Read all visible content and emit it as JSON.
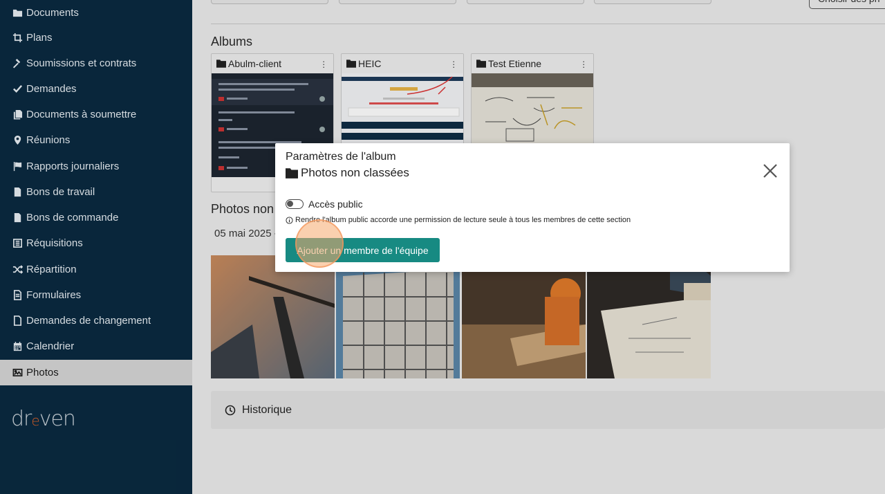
{
  "sidebar": {
    "items": [
      {
        "label": "Documents",
        "icon": "folder-icon"
      },
      {
        "label": "Plans",
        "icon": "crop-icon"
      },
      {
        "label": "Soumissions et contrats",
        "icon": "gavel-icon"
      },
      {
        "label": "Demandes",
        "icon": "check-icon"
      },
      {
        "label": "Documents à soumettre",
        "icon": "copy-icon"
      },
      {
        "label": "Réunions",
        "icon": "map-pin-icon"
      },
      {
        "label": "Rapports journaliers",
        "icon": "flag-icon"
      },
      {
        "label": "Bons de travail",
        "icon": "file-icon"
      },
      {
        "label": "Bons de commande",
        "icon": "file-icon"
      },
      {
        "label": "Réquisitions",
        "icon": "list-icon"
      },
      {
        "label": "Répartition",
        "icon": "shuffle-icon"
      },
      {
        "label": "Formulaires",
        "icon": "file-lines-icon"
      },
      {
        "label": "Demandes de changement",
        "icon": "file-outline-icon"
      },
      {
        "label": "Calendrier",
        "icon": "calendar-icon"
      },
      {
        "label": "Photos",
        "icon": "image-icon",
        "active": true
      }
    ],
    "logo": {
      "pre": "dr",
      "mid": "e",
      "post": "ven"
    }
  },
  "main": {
    "top_button_label": "Choisir des ph",
    "albums_title": "Albums",
    "albums": [
      {
        "name": "Abulm-client"
      },
      {
        "name": "HEIC"
      },
      {
        "name": "Test Etienne"
      }
    ],
    "unsorted_title": "Photos non classées",
    "date_label": "05 mai 2025 -",
    "history_label": "Historique"
  },
  "modal": {
    "title": "Paramètres de l'album",
    "album_name": "Photos non classées",
    "toggle_label": "Accès public",
    "toggle_on": false,
    "info_text": "Rendre l'album public accorde une permission de lecture seule à tous les membres de cette section",
    "team_button_label": "Ajouter un membre de l'équipe"
  },
  "colors": {
    "sidebar_bg": "#0a2a40",
    "accent": "#178a82",
    "active_bg": "#d6d6d6"
  }
}
